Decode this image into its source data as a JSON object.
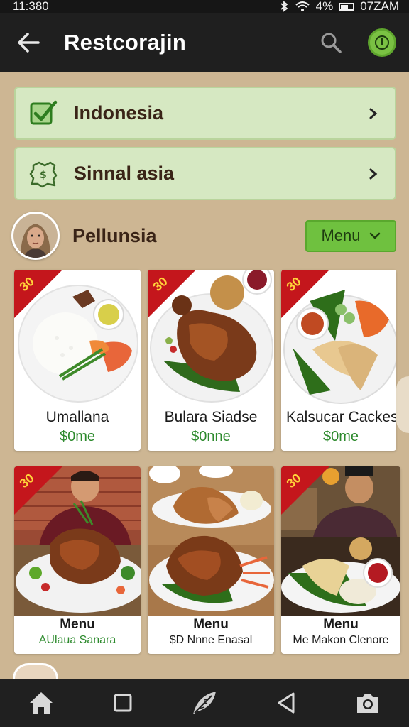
{
  "status": {
    "time": "11:380",
    "battery": "4%",
    "clock_right": "07ZAM"
  },
  "header": {
    "title": "Restcorajin"
  },
  "categories": [
    {
      "label": "Indonesia",
      "icon": "checkbox-check-icon"
    },
    {
      "label": "Sinnal asia",
      "icon": "map-badge-icon"
    }
  ],
  "profile": {
    "name": "Pellunsia",
    "menu_label": "Menu"
  },
  "ribbon_label": "30",
  "dishes": [
    {
      "name": "Umallana",
      "price": "$0me"
    },
    {
      "name": "Bulara Siadse",
      "price": "$0nne"
    },
    {
      "name": "Kalsucar Cackes",
      "price": "$0me"
    }
  ],
  "menus": [
    {
      "title": "Menu",
      "subtitle": "AUlaua Sanara",
      "subtitle_color": "#2d8a2d"
    },
    {
      "title": "Menu",
      "subtitle": "$D Nnne Enasal",
      "subtitle_color": "#1a1a1a"
    },
    {
      "title": "Menu",
      "subtitle": "Me Makon Clenore",
      "subtitle_color": "#1a1a1a"
    }
  ],
  "colors": {
    "accent_green": "#6fc13f",
    "category_bg": "#d6e8c2",
    "page_bg": "#cdb693",
    "ribbon": "#c4161c"
  },
  "nav": [
    "home-icon",
    "recent-apps-icon",
    "feather-icon",
    "back-triangle-icon",
    "camera-icon"
  ]
}
